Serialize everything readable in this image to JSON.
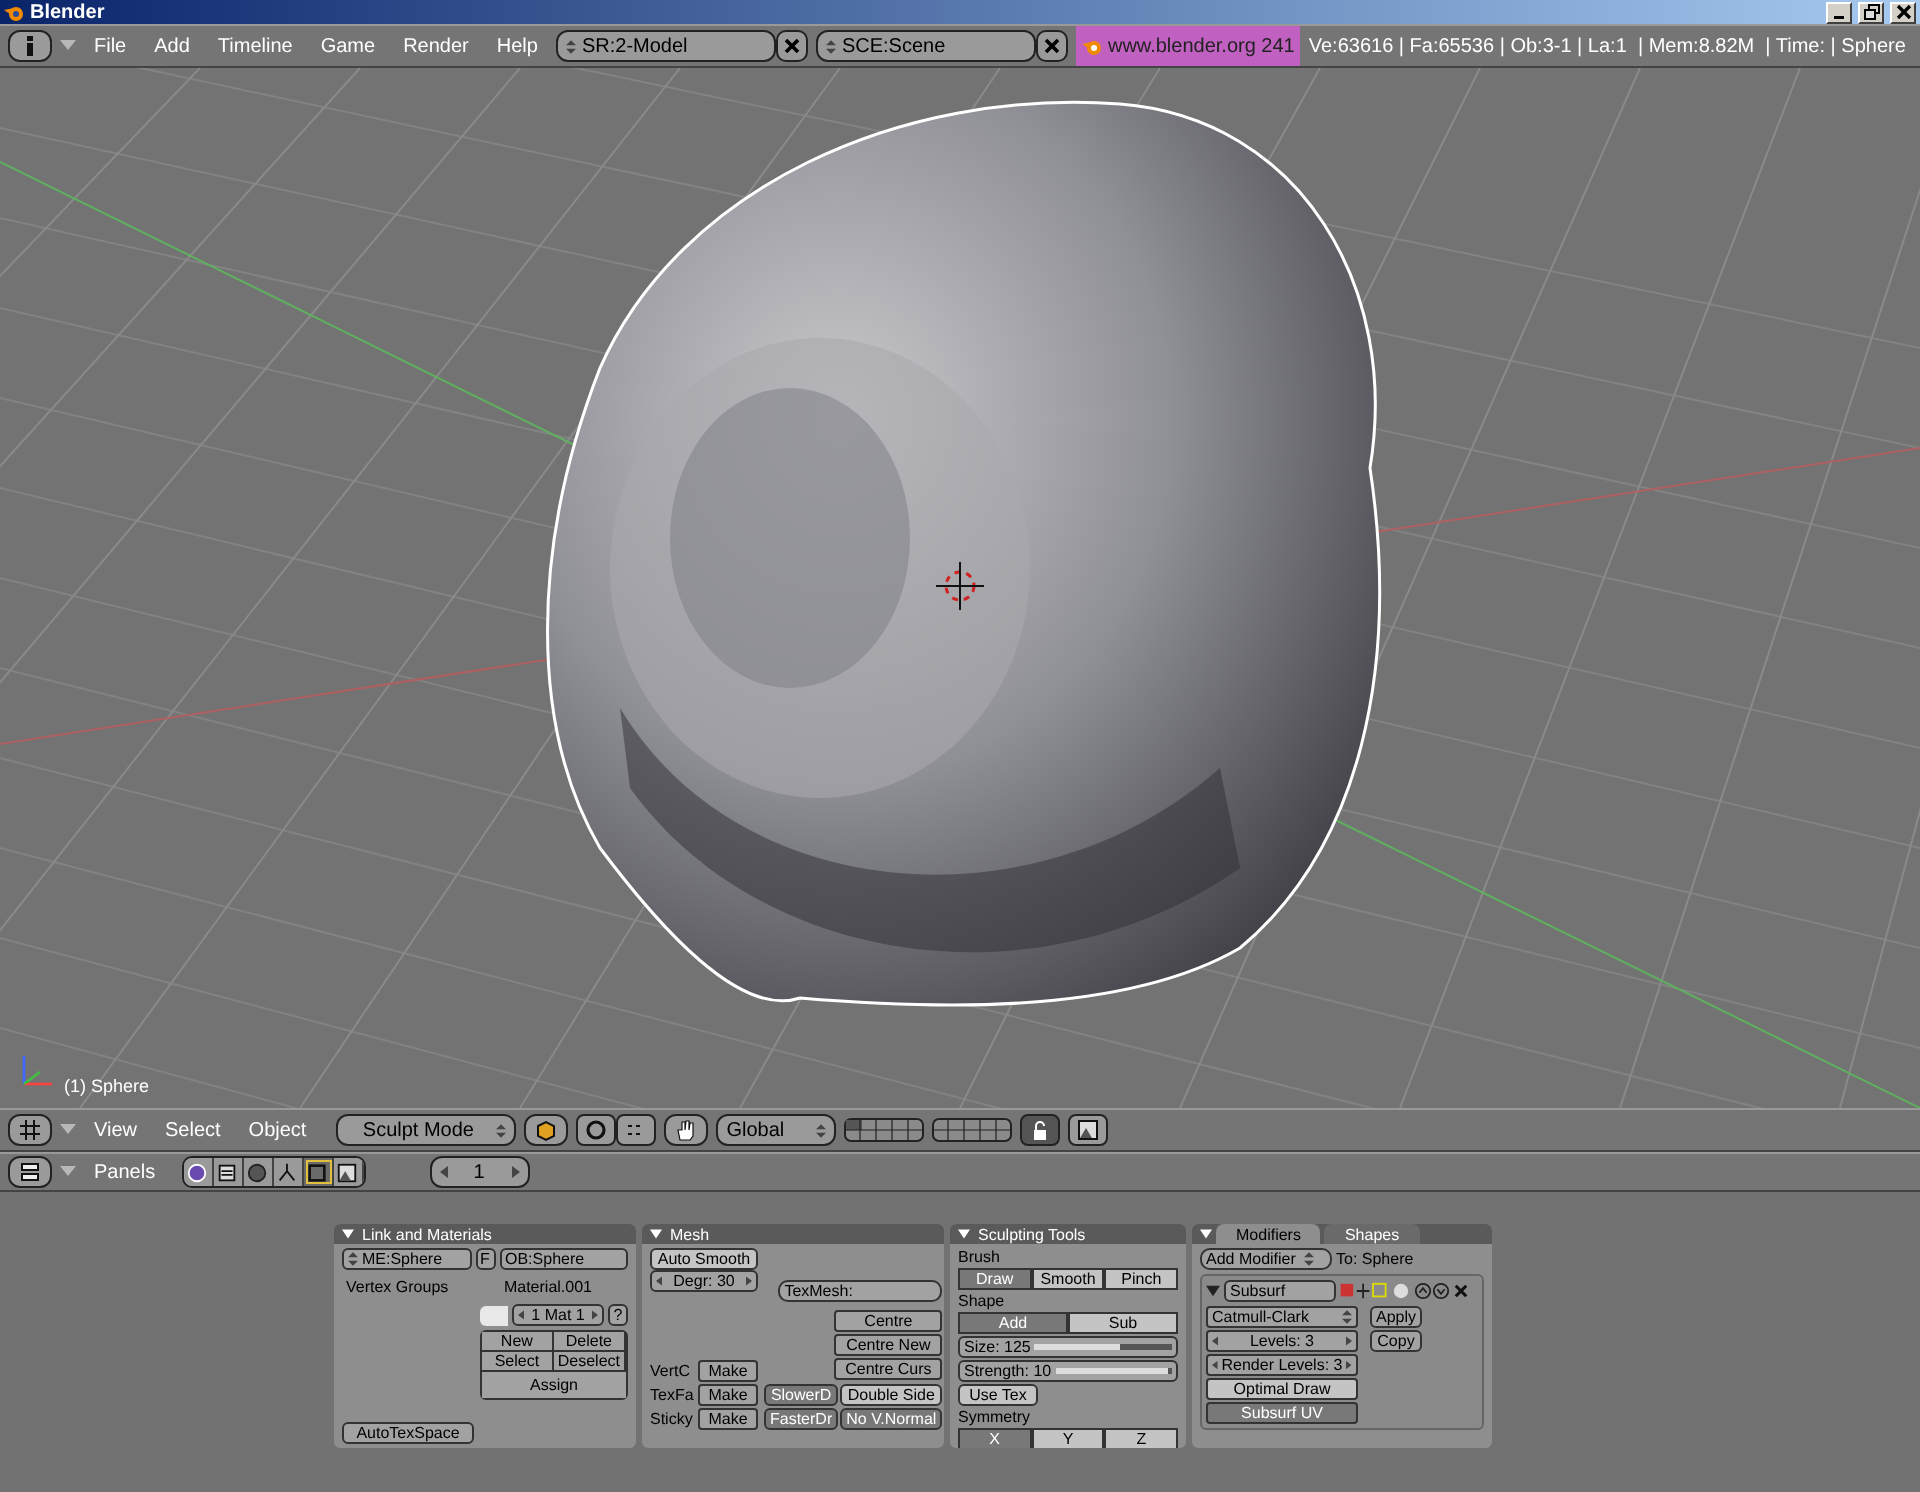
{
  "window": {
    "title": "Blender"
  },
  "menu_bar": {
    "menus": [
      "File",
      "Add",
      "Timeline",
      "Game",
      "Render",
      "Help"
    ],
    "screen": "SR:2-Model",
    "scene": "SCE:Scene",
    "version": "www.blender.org 241",
    "stats": "Ve:63616 | Fa:65536 | Ob:3-1 | La:1  | Mem:8.82M  | Time: | Sphere"
  },
  "viewport": {
    "object_label": "(1) Sphere"
  },
  "viewport_header": {
    "menus": [
      "View",
      "Select",
      "Object"
    ],
    "mode": "Sculpt Mode",
    "orientation": "Global"
  },
  "buttons_header": {
    "menu": "Panels",
    "tabs": [
      {
        "kind": "logic",
        "selected": false
      },
      {
        "kind": "script",
        "selected": false
      },
      {
        "kind": "shading",
        "selected": false
      },
      {
        "kind": "object",
        "selected": false
      },
      {
        "kind": "editing",
        "selected": true
      },
      {
        "kind": "scene",
        "selected": false
      }
    ],
    "frame": "1"
  },
  "link_materials": {
    "title": "Link and Materials",
    "mesh": "ME:Sphere",
    "fake_user": "F",
    "object": "OB:Sphere",
    "vertex_groups": "Vertex Groups",
    "material": "Material.001",
    "mat_index": "1 Mat 1",
    "help": "?",
    "buttons": [
      "New",
      "Delete",
      "Select",
      "Deselect",
      "Assign"
    ],
    "auto_tex_space": "AutoTexSpace"
  },
  "mesh": {
    "title": "Mesh",
    "auto_smooth": {
      "label": "Auto Smooth",
      "on": false
    },
    "degree": "Degr: 30",
    "tex_mesh": "TexMesh:",
    "centre_buttons": [
      "Centre",
      "Centre New",
      "Centre Curs"
    ],
    "make_rows": [
      {
        "label": "VertC",
        "button": "Make"
      },
      {
        "label": "TexFa",
        "button": "Make"
      },
      {
        "label": "Sticky",
        "button": "Make"
      }
    ],
    "toggles": [
      {
        "label": "SlowerD",
        "on": true
      },
      {
        "label": "Double Side",
        "on": false
      },
      {
        "label": "FasterDr",
        "on": true
      },
      {
        "label": "No V.Normal",
        "on": true
      }
    ]
  },
  "sculpting_tools": {
    "title": "Sculpting Tools",
    "brush_label": "Brush",
    "brushes": [
      {
        "label": "Draw",
        "selected": true
      },
      {
        "label": "Smooth",
        "selected": false
      },
      {
        "label": "Pinch",
        "selected": false
      }
    ],
    "shape_label": "Shape",
    "shapes": [
      {
        "label": "Add",
        "selected": true
      },
      {
        "label": "Sub",
        "selected": false
      }
    ],
    "sliders": [
      {
        "label": "Size: 125",
        "level": 0.62
      },
      {
        "label": "Strength: 10",
        "level": 0.97
      }
    ],
    "use_tex": {
      "label": "Use Tex",
      "on": false
    },
    "symmetry_label": "Symmetry",
    "symmetry": [
      {
        "label": "X",
        "on": true
      },
      {
        "label": "Y",
        "on": false
      },
      {
        "label": "Z",
        "on": false
      }
    ]
  },
  "modifiers": {
    "tabs": [
      {
        "label": "Modifiers",
        "selected": true
      },
      {
        "label": "Shapes",
        "selected": false
      }
    ],
    "add_modifier": "Add Modifier",
    "target": "To: Sphere",
    "modifier": {
      "name": "Subsurf",
      "expanded": true,
      "type": "Catmull-Clark",
      "levels": "Levels: 3",
      "render_levels": "Render Levels: 3",
      "options": [
        {
          "label": "Optimal Draw",
          "on": false
        },
        {
          "label": "Subsurf UV",
          "on": true
        }
      ],
      "actions": [
        "Apply",
        "Copy"
      ]
    }
  }
}
